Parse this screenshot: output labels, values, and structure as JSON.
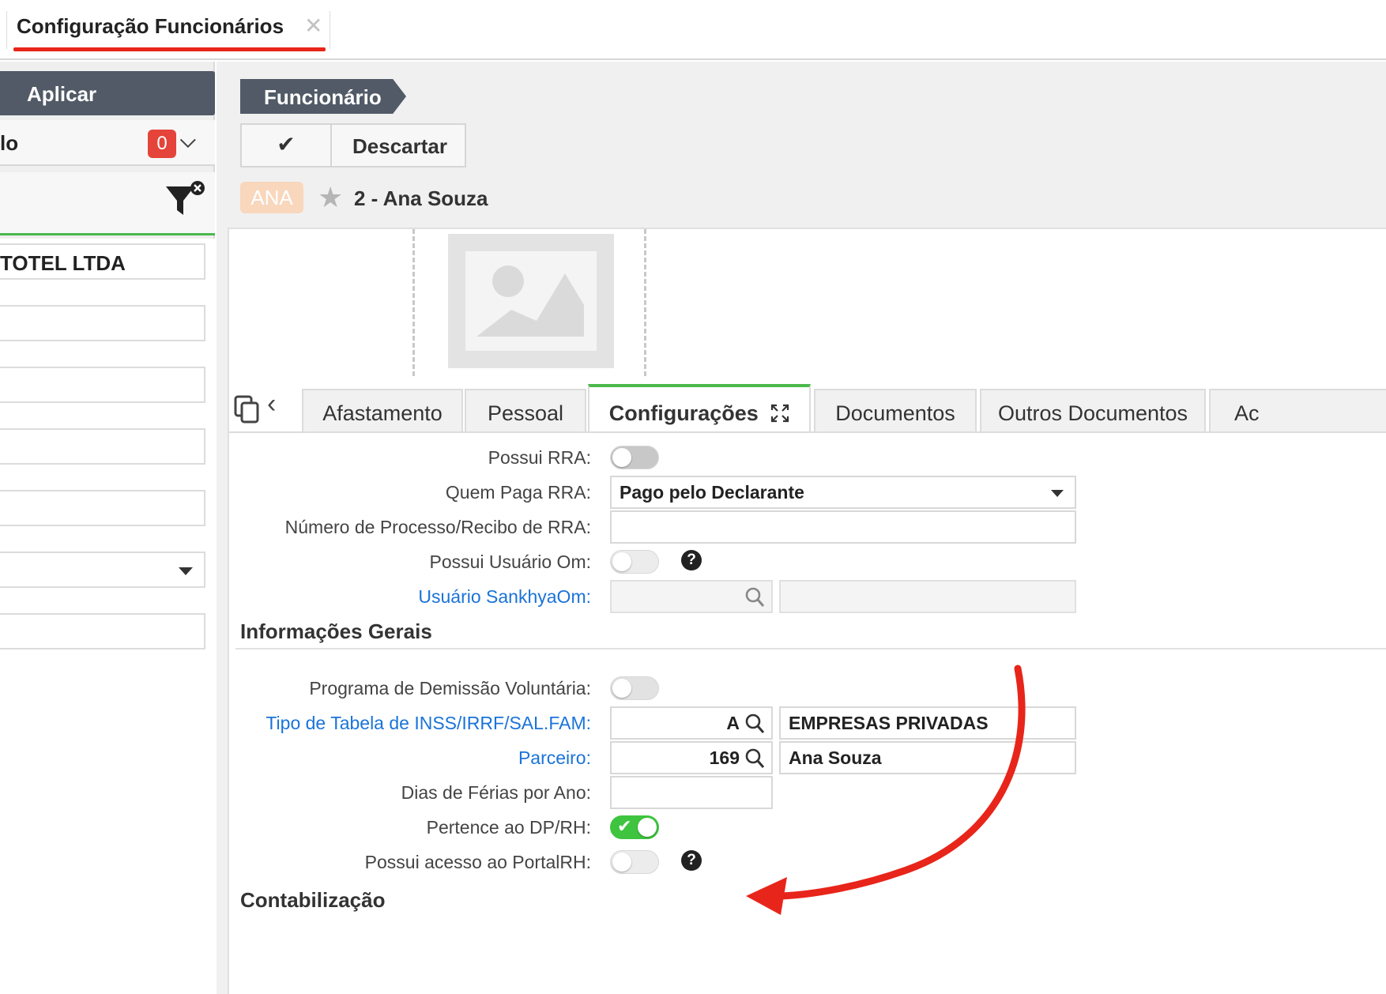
{
  "window": {
    "tab_title": "Configuração Funcionários",
    "close_glyph": "✕"
  },
  "left": {
    "apply_label": "Aplicar",
    "row1_text": "lo",
    "count": "0",
    "company_field": "TOTEL LTDA"
  },
  "main": {
    "breadcrumb": "Funcionário",
    "discard_label": "Descartar",
    "record_badge": "ANA",
    "record_title": "2 - Ana Souza"
  },
  "tabs": [
    {
      "label": "Afastamento"
    },
    {
      "label": "Pessoal"
    },
    {
      "label": "Configurações"
    },
    {
      "label": "Documentos"
    },
    {
      "label": "Outros Documentos"
    },
    {
      "label": "Ac"
    }
  ],
  "form": {
    "possui_rra": {
      "label": "Possui RRA:",
      "on": false
    },
    "quem_paga_rra": {
      "label": "Quem Paga RRA:",
      "value": "Pago pelo Declarante"
    },
    "numero_processo": {
      "label": "Número de Processo/Recibo de RRA:",
      "value": ""
    },
    "possui_usuario_om": {
      "label": "Possui Usuário Om:",
      "on": false,
      "help": "?"
    },
    "usuario_sankhya": {
      "label": "Usuário SankhyaOm:",
      "value": "",
      "desc": ""
    },
    "section_info": "Informações Gerais",
    "programa_demissao": {
      "label": "Programa de Demissão Voluntária:",
      "on": false
    },
    "tipo_tabela": {
      "label": "Tipo de Tabela de INSS/IRRF/SAL.FAM:",
      "code": "A",
      "desc": "EMPRESAS PRIVADAS"
    },
    "parceiro": {
      "label": "Parceiro:",
      "code": "169",
      "desc": "Ana Souza"
    },
    "dias_ferias": {
      "label": "Dias de Férias por Ano:",
      "value": ""
    },
    "pertence_dprh": {
      "label": "Pertence ao DP/RH:",
      "on": true
    },
    "acesso_portal": {
      "label": "Possui acesso ao PortalRH:",
      "on": false,
      "help": "?"
    },
    "section_contab": "Contabilização"
  },
  "colors": {
    "accent_green": "#4cb84c",
    "dark_header": "#515a66",
    "annotation_red": "#e8251a",
    "link_blue": "#1a73d9"
  }
}
